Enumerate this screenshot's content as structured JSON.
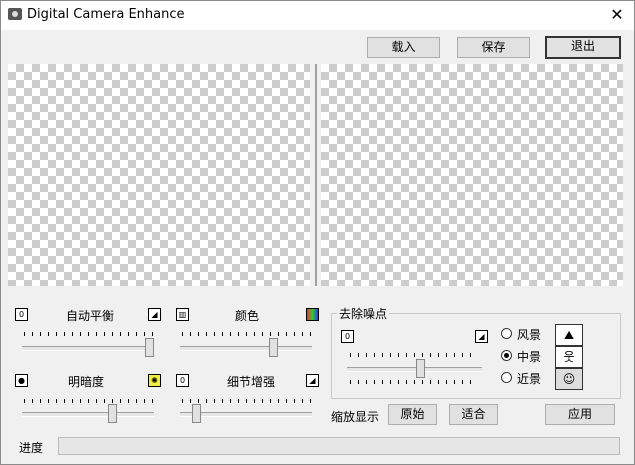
{
  "window": {
    "title": "Digital Camera Enhance",
    "close_glyph": "✕"
  },
  "toolbar": {
    "load": "载入",
    "save": "保存",
    "exit": "退出"
  },
  "controls": {
    "auto_balance": {
      "label": "自动平衡",
      "value": 1.0
    },
    "color": {
      "label": "颜色",
      "value": 0.72
    },
    "brightness": {
      "label": "明暗度",
      "value": 0.7
    },
    "detail": {
      "label": "细节增强",
      "value": 0.1
    }
  },
  "denoise": {
    "title": "去除噪点",
    "value": 0.55,
    "options": [
      {
        "label": "风景",
        "icon": "landscape-icon",
        "selected": false
      },
      {
        "label": "中景",
        "icon": "people-icon",
        "selected": true
      },
      {
        "label": "近景",
        "icon": "face-icon",
        "selected": false
      }
    ]
  },
  "zoom": {
    "label": "缩放显示",
    "original": "原始",
    "fit": "适合"
  },
  "apply": "应用",
  "progress": {
    "label": "进度",
    "value": 0
  }
}
